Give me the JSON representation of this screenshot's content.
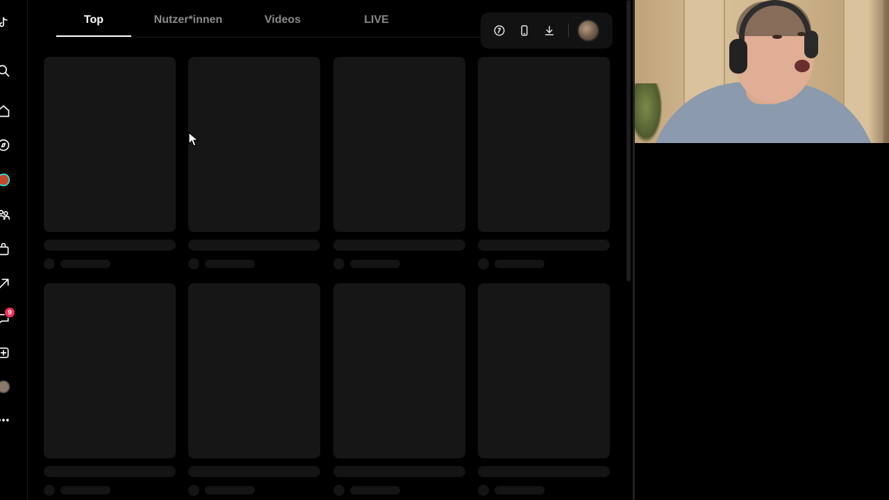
{
  "tabs": [
    {
      "label": "Top",
      "active": true
    },
    {
      "label": "Nutzer*innen",
      "active": false
    },
    {
      "label": "Videos",
      "active": false
    },
    {
      "label": "LIVE",
      "active": false
    }
  ],
  "sidebar": {
    "icons": [
      "tiktok-logo",
      "search-icon",
      "home-icon",
      "explore-icon",
      "live-avatar",
      "friends-icon",
      "shop-icon",
      "upload-icon",
      "messages-icon",
      "add-icon",
      "profile-avatar",
      "more-icon"
    ],
    "messages_badge": "9"
  },
  "toolbar": {
    "icons": [
      "coin-icon",
      "phone-icon",
      "download-icon"
    ],
    "avatar": "profile-avatar"
  },
  "results": {
    "state": "loading",
    "placeholder_cards_visible": 8
  },
  "colors": {
    "background": "#000000",
    "card_placeholder": "#161616",
    "badge": "#fe2c55",
    "tab_active": "#ffffff",
    "tab_inactive": "#8a8a8a"
  }
}
